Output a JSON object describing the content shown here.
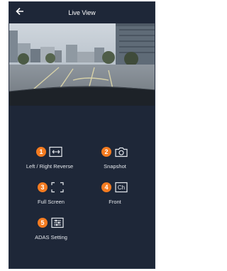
{
  "header": {
    "title": "Live View",
    "back_icon": "arrow-left-icon"
  },
  "video": {
    "description_icon": "camera-feed"
  },
  "controls": [
    {
      "number": "1",
      "label": "Left / Right Reverse",
      "icon": "flip-horizontal-icon"
    },
    {
      "number": "2",
      "label": "Snapshot",
      "icon": "camera-icon"
    },
    {
      "number": "3",
      "label": "Full Screen",
      "icon": "fullscreen-icon"
    },
    {
      "number": "4",
      "label": "Front",
      "icon": "camera-channel-icon",
      "icon_text": "Ch"
    },
    {
      "number": "5",
      "label": "ADAS Setting",
      "icon": "adas-settings-icon"
    }
  ],
  "colors": {
    "background": "#1e2738",
    "badge": "#f47b20",
    "text": "#e6e9ee"
  }
}
